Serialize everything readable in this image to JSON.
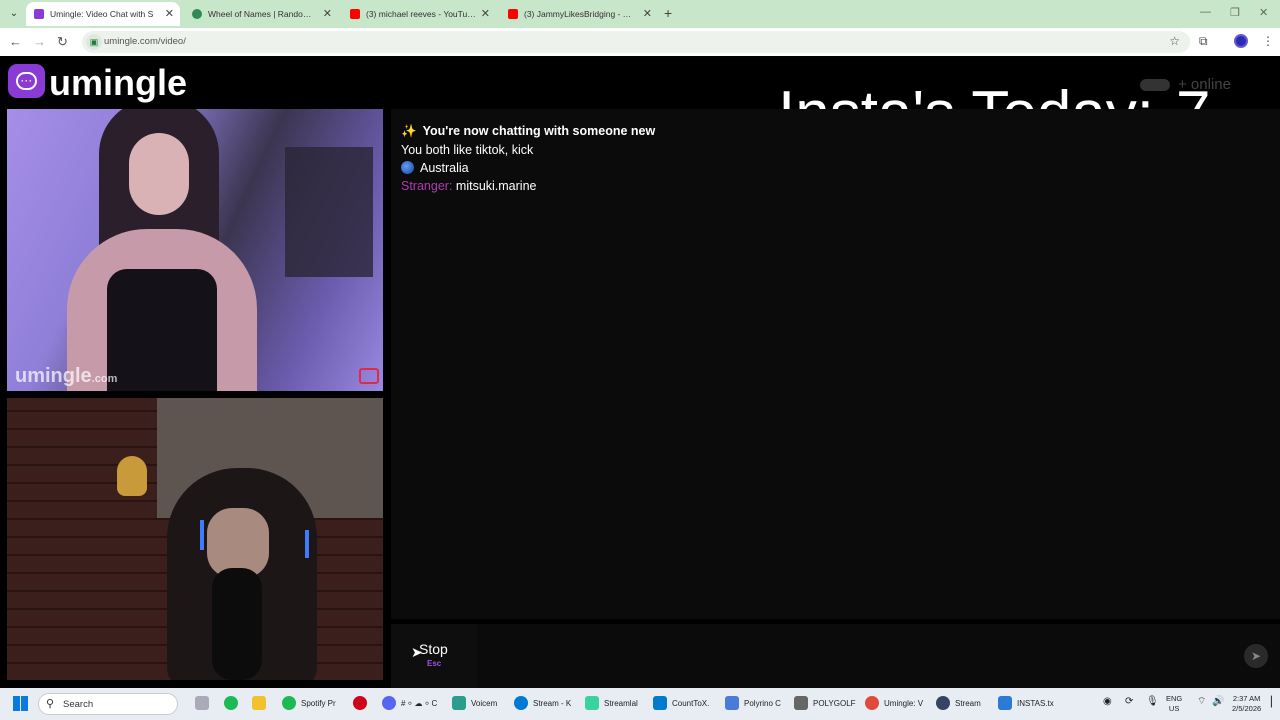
{
  "browser": {
    "tabs": [
      {
        "title": "Umingle: Video Chat with S",
        "favicon_color": "#8a3bd6",
        "active": true
      },
      {
        "title": "Wheel of Names | Random nam",
        "favicon_color": "#2e8b57",
        "active": false
      },
      {
        "title": "(3) michael reeves - YouTube",
        "favicon_color": "#ff0000",
        "active": false
      },
      {
        "title": "(3) JammyLikesBridging - YouTu",
        "favicon_color": "#ff0000",
        "active": false
      }
    ],
    "url": "umingle.com/video/"
  },
  "page": {
    "brand": "umingle",
    "online_text": "+ online",
    "overlay_label": "Insta's Today:",
    "overlay_count": "7",
    "video_watermark": "umingle",
    "video_watermark_suffix": ".com"
  },
  "chat": {
    "status": "You're now chatting with someone new",
    "common": "You both like tiktok, kick",
    "country": "Australia",
    "stranger_label": "Stranger:",
    "stranger_message": "mitsuki.marine"
  },
  "controls": {
    "stop_label": "Stop",
    "stop_key": "Esc"
  },
  "taskbar": {
    "search_label": "Search",
    "apps": [
      {
        "label": "Spotify Pr",
        "color": "#1db954"
      },
      {
        "label": "# ⸰ ☁ ⸰ C",
        "color": "#5865f2"
      },
      {
        "label": "Voicem",
        "color": "#2a9d8f"
      },
      {
        "label": "Stream - K",
        "color": "#0078d4"
      },
      {
        "label": "Streamlal",
        "color": "#3ad29f"
      },
      {
        "label": "CountToX.",
        "color": "#007acc"
      },
      {
        "label": "Polyrino C",
        "color": "#4a7bd6"
      },
      {
        "label": "POLYGOLF",
        "color": "#666666"
      },
      {
        "label": "Umingle: V",
        "color": "#e04a3a"
      },
      {
        "label": "Stream",
        "color": "#334466"
      },
      {
        "label": "INSTAS.tx",
        "color": "#2a7ad6"
      }
    ],
    "lang_top": "ENG",
    "lang_bottom": "US",
    "time": "2:37 AM",
    "date": "2/5/2026"
  }
}
